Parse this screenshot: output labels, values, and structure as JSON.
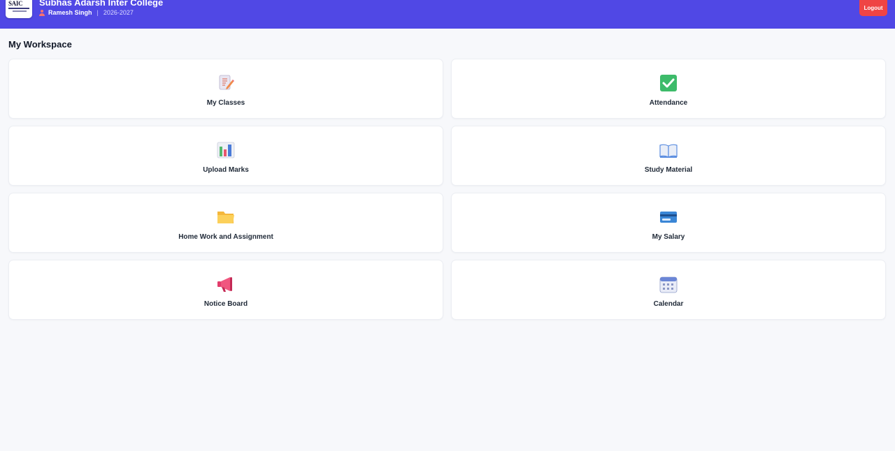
{
  "header": {
    "college_name": "Subhas Adarsh Inter College",
    "user_name": "Ramesh Singh",
    "separator": "|",
    "session": "2026-2027",
    "logout_label": "Logout",
    "bg_color": "#5048e5",
    "logout_color": "#ef4444"
  },
  "workspace": {
    "title": "My Workspace",
    "cards": [
      {
        "label": "My Classes",
        "icon": "memo-icon"
      },
      {
        "label": "Attendance",
        "icon": "checkbox-icon"
      },
      {
        "label": "Upload Marks",
        "icon": "bar-chart-icon"
      },
      {
        "label": "Study Material",
        "icon": "book-icon"
      },
      {
        "label": "Home Work and Assignment",
        "icon": "folder-icon"
      },
      {
        "label": "My Salary",
        "icon": "credit-card-icon"
      },
      {
        "label": "Notice Board",
        "icon": "megaphone-icon"
      },
      {
        "label": "Calendar",
        "icon": "calendar-icon"
      }
    ]
  }
}
